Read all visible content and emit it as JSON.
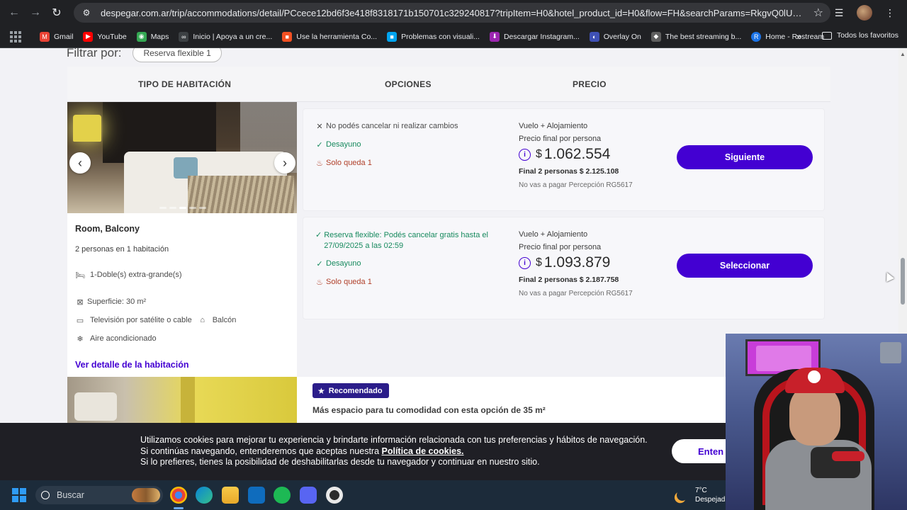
{
  "browser": {
    "url": "despegar.com.ar/trip/accommodations/detail/PCcece12bd6f3e418f8318171b150701c329240817?tripItem=H0&hotel_product_id=H0&flow=FH&searchParams=RkgvQ0lUXzk4Mi9DSV...",
    "bookmarks": [
      {
        "label": "Gmail",
        "color": "#ea4335",
        "glyph": "M"
      },
      {
        "label": "YouTube",
        "color": "#ff0000",
        "glyph": "▶"
      },
      {
        "label": "Maps",
        "color": "#34a853",
        "glyph": "◉"
      },
      {
        "label": "Inicio | Apoya a un cre...",
        "color": "#3c4043",
        "glyph": "∞"
      },
      {
        "label": "Use la herramienta Co...",
        "color": "#f25022",
        "glyph": "■"
      },
      {
        "label": "Problemas con visuali...",
        "color": "#00a4ef",
        "glyph": "■"
      },
      {
        "label": "Descargar Instagram...",
        "color": "#9c27b0",
        "glyph": "⬇"
      },
      {
        "label": "Overlay On",
        "color": "#3f51b5",
        "glyph": "◐"
      },
      {
        "label": "The best streaming b...",
        "color": "#5f5f5f",
        "glyph": "◆"
      },
      {
        "label": "Home - Restream",
        "color": "#1a73e8",
        "glyph": "R"
      }
    ],
    "all_bookmarks": "Todos los favoritos"
  },
  "filter": {
    "title": "Filtrar por:",
    "chip": "Reserva flexible  1"
  },
  "headers": {
    "room_type": "TIPO DE HABITACIÓN",
    "options": "OPCIONES",
    "price": "PRECIO"
  },
  "room": {
    "name": "Room, Balcony",
    "capacity": "2 personas en 1 habitación",
    "bed": "1-Doble(s) extra-grande(s)",
    "surface": "Superficie: 30 m²",
    "tv": "Televisión por satélite o cable",
    "balcony": "Balcón",
    "ac": "Aire acondicionado",
    "detail_link": "Ver detalle de la habitación"
  },
  "options": [
    {
      "policy": "No podés cancelar ni realizar cambios",
      "breakfast": "Desayuno",
      "availability": "Solo queda 1",
      "kind": "Vuelo + Alojamiento",
      "final_label": "Precio final por persona",
      "currency": "$",
      "amount": "1.062.554",
      "total": "Final 2 personas $ 2.125.108",
      "note": "No vas a pagar Percepción RG5617",
      "cta": "Siguiente"
    },
    {
      "policy": "Reserva flexible: Podés cancelar gratis hasta el 27/09/2025 a las 02:59",
      "breakfast": "Desayuno",
      "availability": "Solo queda 1",
      "kind": "Vuelo + Alojamiento",
      "final_label": "Precio final por persona",
      "currency": "$",
      "amount": "1.093.879",
      "total": "Final 2 personas $ 2.187.758",
      "note": "No vas a pagar Percepción RG5617",
      "cta": "Seleccionar"
    }
  ],
  "next_room": {
    "badge": "Recomendado",
    "text": "Más espacio para tu comodidad con esta opción de 35 m²"
  },
  "cookie": {
    "line1": "Utilizamos cookies para mejorar tu experiencia y brindarte información relacionada con tus preferencias y hábitos de navegación.",
    "line2_pre": "Si continúas navegando, entenderemos que aceptas nuestra ",
    "line2_link": "Política de cookies.",
    "line3": "Si lo prefieres, tienes la posibilidad de deshabilitarlas desde tu navegador y continuar en nuestro sitio.",
    "button": "Enten"
  },
  "taskbar": {
    "search_placeholder": "Buscar",
    "temp": "7°C",
    "weather": "Despejad"
  },
  "colors": {
    "brand": "#4300d2",
    "green": "#178a5e",
    "red": "#b0402a"
  }
}
